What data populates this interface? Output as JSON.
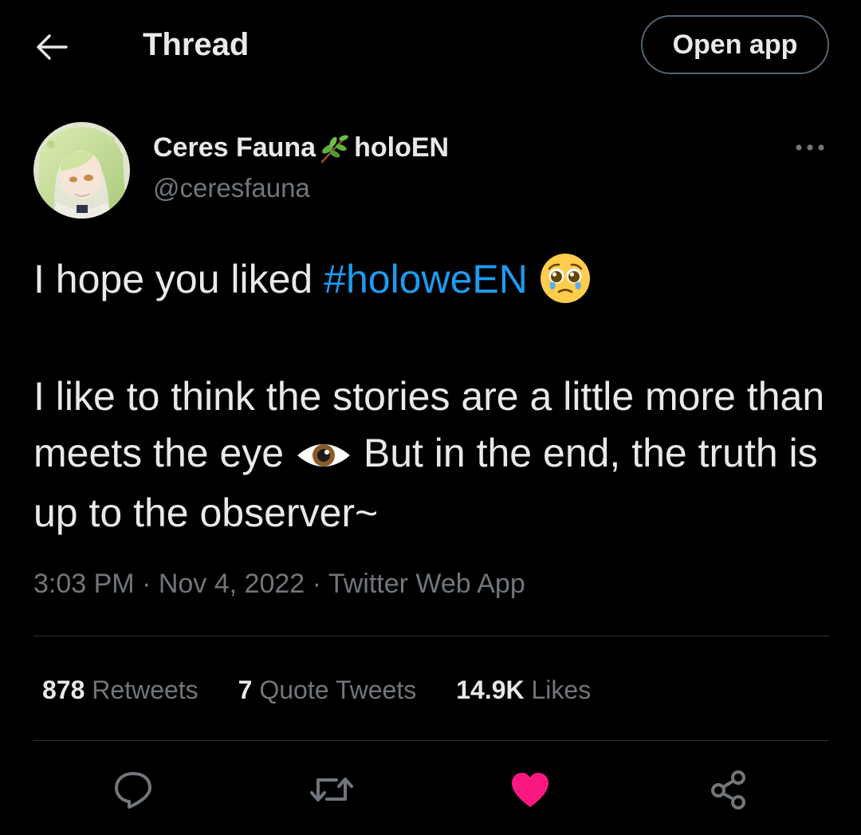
{
  "header": {
    "title": "Thread",
    "open_app_label": "Open app",
    "back_icon": "arrow-left-icon"
  },
  "author": {
    "name_part1": "Ceres Fauna",
    "name_part2": "holoEN",
    "handle": "@ceresfauna",
    "badge_icon": "herb-sprig-icon",
    "more_icon": "more-horizontal-icon"
  },
  "tweet": {
    "line1_text": "I hope you liked ",
    "hashtag": "#holoweEN",
    "line1_emoji": "pleading-face-emoji",
    "line2_part1": "I like to think the stories are a little more than meets the eye ",
    "line2_emoji": "eye-emoji",
    "line2_part2": " But in the end, the truth is up to the observer~"
  },
  "meta": {
    "time": "3:03 PM",
    "sep1": " · ",
    "date": "Nov 4, 2022",
    "sep2": " · ",
    "source": "Twitter Web App"
  },
  "stats": {
    "retweets_count": "878",
    "retweets_label": "Retweets",
    "quotes_count": "7",
    "quotes_label": "Quote Tweets",
    "likes_count": "14.9K",
    "likes_label": "Likes"
  },
  "actions": {
    "reply_icon": "reply-icon",
    "retweet_icon": "retweet-icon",
    "like_icon": "heart-icon",
    "share_icon": "share-icon",
    "like_active": true
  },
  "colors": {
    "background": "#000000",
    "text_primary": "#e7e9ea",
    "text_secondary": "#71767b",
    "accent_blue": "#1d9bf0",
    "like_pink": "#f91880",
    "divider": "#2f3336"
  }
}
